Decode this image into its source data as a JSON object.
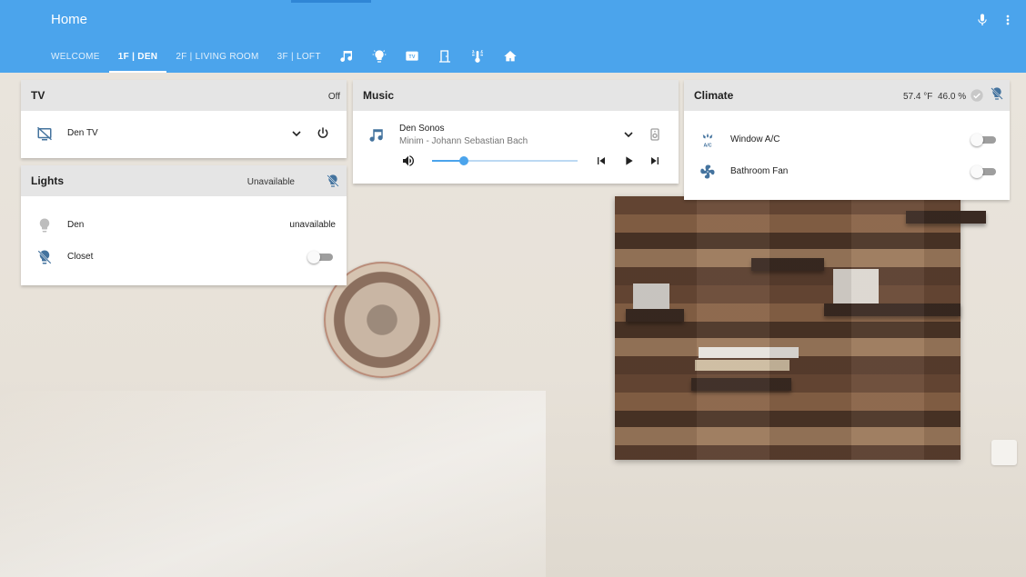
{
  "header": {
    "title": "Home",
    "tabs": [
      {
        "label": "WELCOME"
      },
      {
        "label": "1F | DEN",
        "active": true
      },
      {
        "label": "2F | LIVING ROOM"
      },
      {
        "label": "3F | LOFT"
      }
    ],
    "icon_tabs": [
      "music-note-icon",
      "lightbulb-icon",
      "tv-icon",
      "door-icon",
      "thermometer-lines-icon",
      "home-icon"
    ],
    "accent_color": "#4ba4ec"
  },
  "tv_card": {
    "title": "TV",
    "state": "Off",
    "device": {
      "name": "Den TV",
      "icon": "tv-off-icon"
    }
  },
  "lights_card": {
    "title": "Lights",
    "state": "Unavailable",
    "items": [
      {
        "name": "Den",
        "value": "unavailable",
        "icon": "lightbulb-icon"
      },
      {
        "name": "Closet",
        "icon": "lightbulb-off-icon",
        "toggle": "off"
      }
    ]
  },
  "music_card": {
    "title": "Music",
    "player": {
      "name": "Den Sonos",
      "track": "Minim - Johann Sebastian Bach",
      "volume_fraction": 0.22
    }
  },
  "climate_card": {
    "title": "Climate",
    "temperature": "57.4 °F",
    "humidity": "46.0 %",
    "items": [
      {
        "name": "Window A/C",
        "icon": "ac-icon",
        "toggle": "off"
      },
      {
        "name": "Bathroom Fan",
        "icon": "fan-icon",
        "toggle": "off"
      }
    ]
  }
}
